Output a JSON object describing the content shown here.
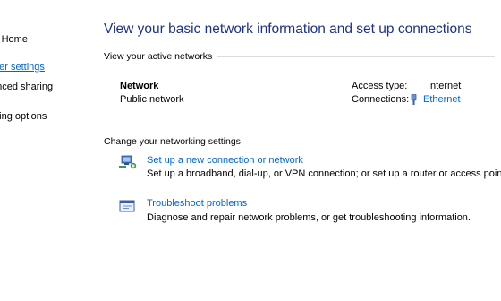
{
  "sidebar": {
    "items": [
      {
        "label": "el Home"
      },
      {
        "label": "pter settings"
      },
      {
        "label": "anced sharing"
      },
      {
        "label": "ming options"
      }
    ]
  },
  "main": {
    "title": "View your basic network information and set up connections",
    "active_section": "View your active networks",
    "network": {
      "name": "Network",
      "category": "Public network",
      "access_type_label": "Access type:",
      "access_type_value": "Internet",
      "connections_label": "Connections:",
      "connections_value": "Ethernet"
    },
    "settings_section": "Change your networking settings",
    "tasks": [
      {
        "title": "Set up a new connection or network",
        "desc": "Set up a broadband, dial-up, or VPN connection; or set up a router or access point.",
        "icon": "network-setup-icon"
      },
      {
        "title": "Troubleshoot problems",
        "desc": "Diagnose and repair network problems, or get troubleshooting information.",
        "icon": "troubleshoot-icon"
      }
    ]
  },
  "colors": {
    "title": "#1e3287",
    "link": "#0066cc",
    "rule": "#dcdcdc"
  }
}
